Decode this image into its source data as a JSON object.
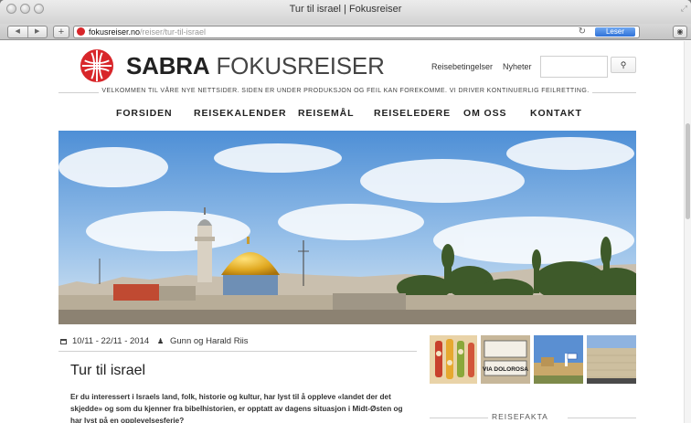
{
  "window": {
    "title": "Tur til israel | Fokusreiser"
  },
  "browser": {
    "url_host": "fokusreiser.no",
    "url_path": "/reiser/tur-til-israel",
    "reader_label": "Leser",
    "back_icon": "back-arrow-icon",
    "forward_icon": "forward-arrow-icon"
  },
  "header": {
    "brand_bold": "SABRA",
    "brand_light": "FOKUSREISER",
    "links": [
      "Reisebetingelser",
      "Nyheter"
    ],
    "search_placeholder": "",
    "search_button": "🔍"
  },
  "banner": {
    "welcome": "VELKOMMEN TIL VÅRE NYE NETTSIDER. SIDEN ER UNDER PRODUKSJON OG FEIL KAN FOREKOMME. VI DRIVER KONTINUERLIG FEILRETTING."
  },
  "nav": {
    "items": [
      "FORSIDEN",
      "REISEKALENDER",
      "REISEMÅL",
      "REISELEDERE",
      "OM OSS",
      "KONTAKT"
    ]
  },
  "trip": {
    "dates": "10/11 - 22/11 - 2014",
    "leaders": "Gunn og Harald Riis",
    "title": "Tur til israel",
    "intro": "Er du interessert i Israels land, folk, historie og kultur, har lyst til å oppleve «landet der det skjedde» og som du kjenner fra bibelhistorien, er opptatt av dagens situasjon i Midt-Østen og har lyst på en opplevelsesferie?"
  },
  "sidebar": {
    "thumb_sign_text": "VIA DOLOROSA",
    "facts_title": "REISEFAKTA"
  },
  "colors": {
    "brand_red": "#d8262a",
    "reader_blue": "#2f72d8"
  }
}
